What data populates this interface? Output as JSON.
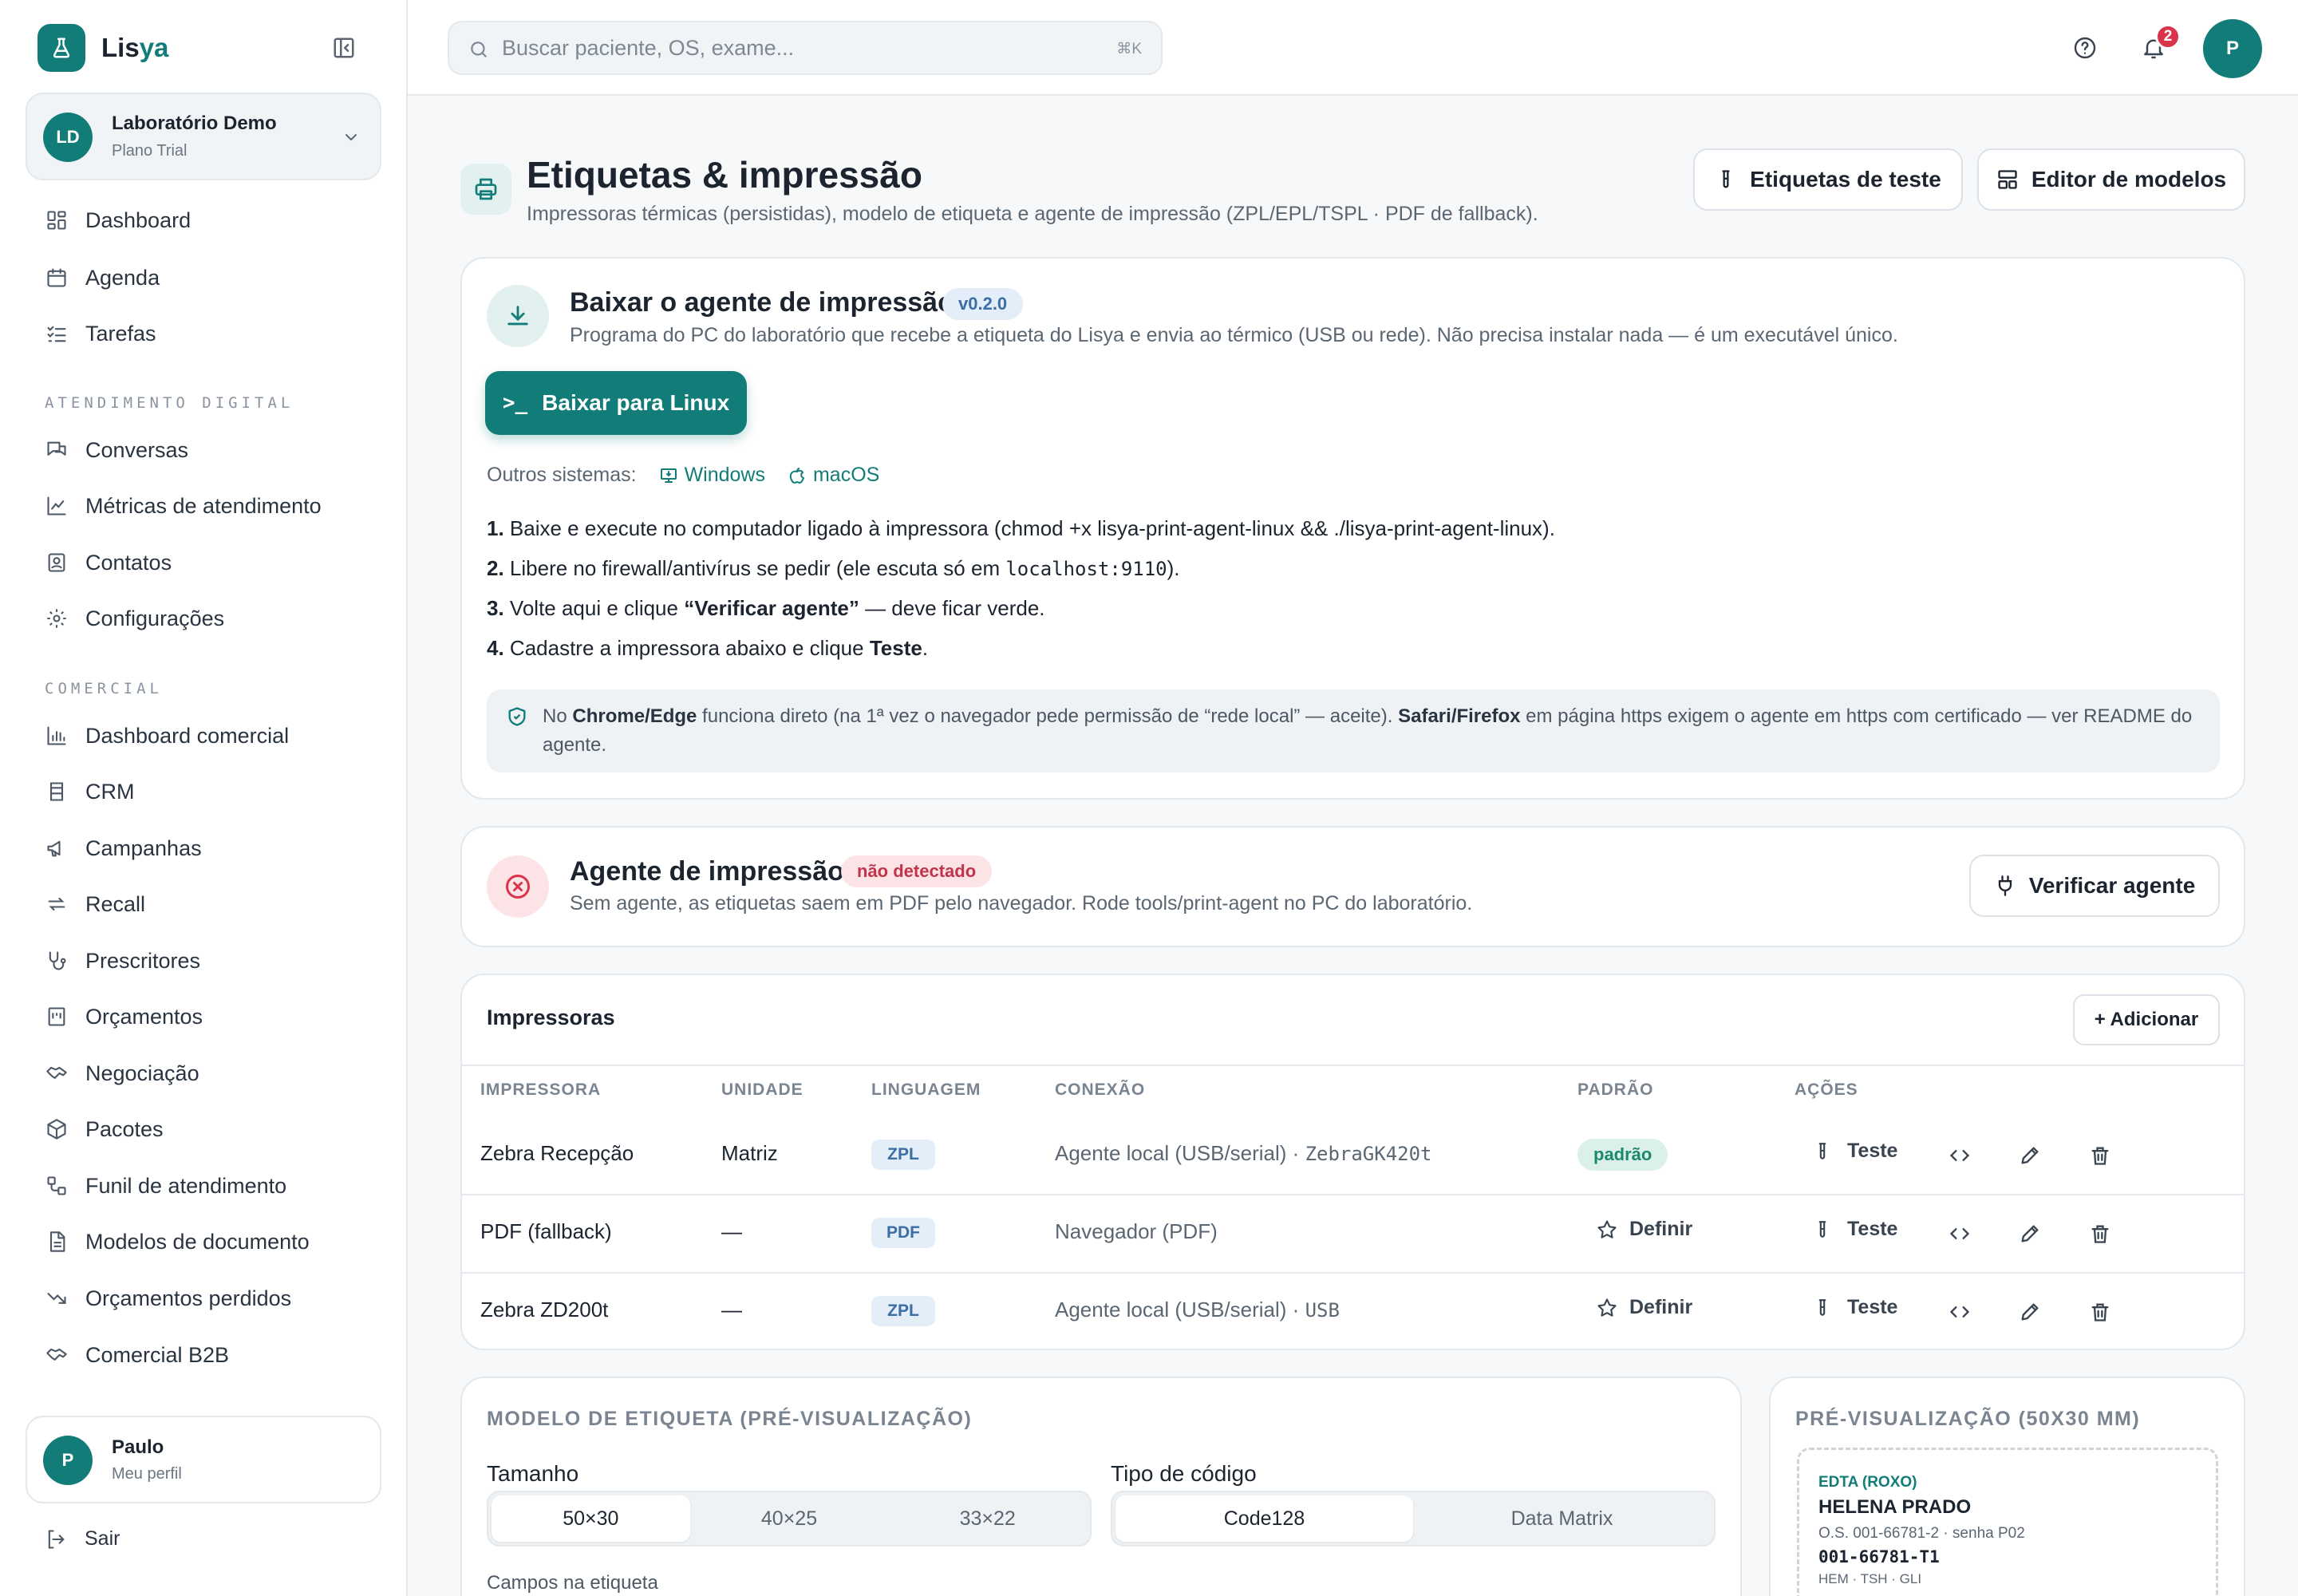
{
  "brand": {
    "name_prefix": "Lis",
    "name_suffix": "ya"
  },
  "org": {
    "initials": "LD",
    "name": "Laboratório Demo",
    "plan": "Plano Trial"
  },
  "nav": {
    "dashboard": "Dashboard",
    "agenda": "Agenda",
    "tarefas": "Tarefas",
    "section_digital": "ATENDIMENTO DIGITAL",
    "conversas": "Conversas",
    "metricas": "Métricas de atendimento",
    "contatos": "Contatos",
    "configuracoes": "Configurações",
    "section_comercial": "COMERCIAL",
    "dashboard_comercial": "Dashboard comercial",
    "crm": "CRM",
    "campanhas": "Campanhas",
    "recall": "Recall",
    "prescritores": "Prescritores",
    "orcamentos": "Orçamentos",
    "negociacao": "Negociação",
    "pacotes": "Pacotes",
    "funil": "Funil de atendimento",
    "modelos_documento": "Modelos de documento",
    "orcamentos_perdidos": "Orçamentos perdidos",
    "comercial_b2b": "Comercial B2B"
  },
  "user": {
    "initial": "P",
    "name": "Paulo",
    "sub": "Meu perfil",
    "logout": "Sair"
  },
  "topbar": {
    "search_placeholder": "Buscar paciente, OS, exame...",
    "shortcut": "⌘K",
    "notifications": "2",
    "avatar": "P"
  },
  "page": {
    "title": "Etiquetas & impressão",
    "subtitle": "Impressoras térmicas (persistidas), modelo de etiqueta e agente de impressão (ZPL/EPL/TSPL · PDF de fallback).",
    "btn_test_labels": "Etiquetas de teste",
    "btn_template_editor": "Editor de modelos"
  },
  "download": {
    "title": "Baixar o agente de impressão",
    "version": "v0.2.0",
    "desc": "Programa do PC do laboratório que recebe a etiqueta do Lisya e envia ao térmico (USB ou rede). Não precisa instalar nada — é um executável único.",
    "button": "Baixar para Linux",
    "other_label": "Outros sistemas:",
    "windows": "Windows",
    "macos": "macOS",
    "step1_num": "1.",
    "step1": "Baixe e execute no computador ligado à impressora (chmod +x lisya-print-agent-linux && ./lisya-print-agent-linux).",
    "step2_num": "2.",
    "step2_a": "Libere no firewall/antivírus se pedir (ele escuta só em ",
    "step2_code": "localhost:9110",
    "step2_b": ").",
    "step3_num": "3.",
    "step3_a": "Volte aqui e clique ",
    "step3_bold": "“Verificar agente”",
    "step3_b": " — deve ficar verde.",
    "step4_num": "4.",
    "step4_a": "Cadastre a impressora abaixo e clique ",
    "step4_bold": "Teste",
    "step4_b": ".",
    "note_a": "No ",
    "note_b1": "Chrome/Edge",
    "note_c": " funciona direto (na 1ª vez o navegador pede permissão de “rede local” — aceite). ",
    "note_b2": "Safari/Firefox",
    "note_d": " em página https exigem o agente em https com certificado — ver README do agente."
  },
  "agent": {
    "title": "Agente de impressão",
    "status": "não detectado",
    "desc": "Sem agente, as etiquetas saem em PDF pelo navegador. Rode tools/print-agent no PC do laboratório.",
    "verify": "Verificar agente"
  },
  "printers": {
    "title": "Impressoras",
    "add": "+ Adicionar",
    "headers": [
      "IMPRESSORA",
      "UNIDADE",
      "LINGUAGEM",
      "CONEXÃO",
      "PADRÃO",
      "AÇÕES"
    ],
    "default_label": "padrão",
    "define_label": "Definir",
    "test_label": "Teste",
    "rows": [
      {
        "name": "Zebra Recepção",
        "unit": "Matriz",
        "lang": "ZPL",
        "conn": "Agente local (USB/serial) · ",
        "conn_code": "ZebraGK420t"
      },
      {
        "name": "PDF (fallback)",
        "unit": "—",
        "lang": "PDF",
        "conn": "Navegador (PDF)",
        "conn_code": ""
      },
      {
        "name": "Zebra ZD200t",
        "unit": "—",
        "lang": "ZPL",
        "conn": "Agente local (USB/serial) · ",
        "conn_code": "USB"
      }
    ]
  },
  "template": {
    "caption": "MODELO DE ETIQUETA (PRÉ-VISUALIZAÇÃO)",
    "size_label": "Tamanho",
    "sizes": [
      "50×30",
      "40×25",
      "33×22"
    ],
    "code_label": "Tipo de código",
    "codes": [
      "Code128",
      "Data Matrix"
    ],
    "fields_label": "Campos na etiqueta"
  },
  "preview": {
    "caption": "PRÉ-VISUALIZAÇÃO (50X30 MM)",
    "tube": "EDTA (ROXO)",
    "patient": "HELENA PRADO",
    "os": "O.S. 001-66781-2 · senha P02",
    "code": "001-66781-T1",
    "exams": "HEM · TSH · GLI"
  },
  "colors": {
    "primary": "#127d78",
    "danger": "#d9344c",
    "success": "#1b8a6b"
  }
}
